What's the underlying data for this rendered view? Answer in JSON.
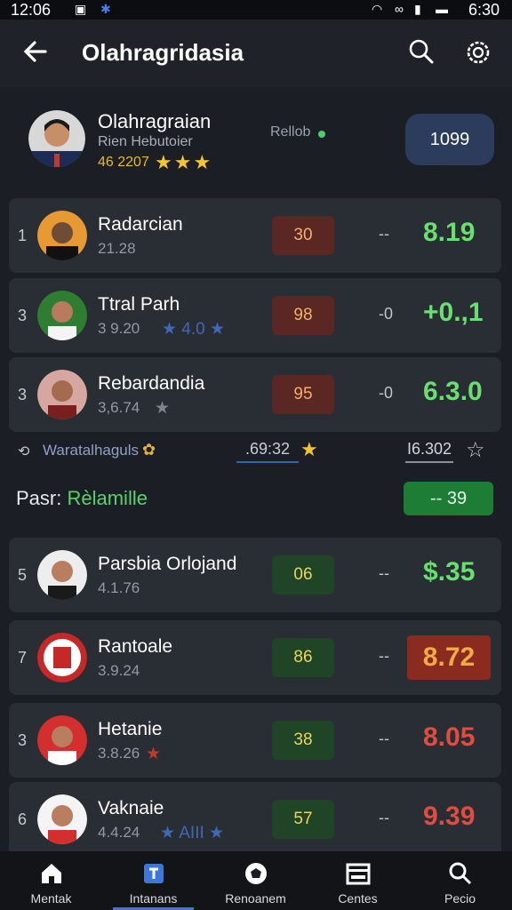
{
  "status": {
    "time_left": "12:06",
    "time_right": "6:30"
  },
  "app_bar": {
    "title": "Olahragridasia"
  },
  "profile": {
    "name": "Olahragraian",
    "subtitle": "Rien Hebutoier",
    "score": "46 2207",
    "stars": "★★★",
    "status": "Rellob",
    "badge": "1099"
  },
  "rows": [
    {
      "rank": "1",
      "name": "Radarcian",
      "sub": "21.28",
      "extra": "",
      "score": "30",
      "dash": "--",
      "value": "8.19",
      "value_color": "#69df6f",
      "score_bg": "#5a2722",
      "score_fg": "#f2b16c"
    },
    {
      "rank": "3",
      "name": "Ttral Parh",
      "sub": "3 9.20",
      "extra": "★ 4.0 ★",
      "extra_color": "#4068b8",
      "score": "98",
      "dash": "-0",
      "value": "+0.,1",
      "value_color": "#69df6f",
      "score_bg": "#5a2722",
      "score_fg": "#f2b16c"
    },
    {
      "rank": "3",
      "name": "Rebardandia",
      "sub": "3,6.74",
      "extra": "★",
      "extra_color": "#7f858d",
      "score": "95",
      "dash": "-0",
      "value": "6.3.0",
      "value_color": "#69df6f",
      "score_bg": "#5a2722",
      "score_fg": "#f2b16c"
    },
    {
      "rank": "5",
      "name": "Parsbia Orlojand",
      "sub": "4.1.76",
      "extra": "",
      "score": "06",
      "dash": "--",
      "value": "$.35",
      "value_color": "#69df6f",
      "score_bg": "#1f4526",
      "score_fg": "#e9d65b"
    },
    {
      "rank": "7",
      "name": "Rantoale",
      "sub": "3.9.24",
      "extra": "",
      "score": "86",
      "dash": "--",
      "value": "8.72",
      "value_color": "#f0ab45",
      "value_bg": "#8b2a1f",
      "score_bg": "#1f4526",
      "score_fg": "#e9d65b"
    },
    {
      "rank": "3",
      "name": "Hetanie",
      "sub": "3.8.26",
      "extra": "★",
      "extra_color": "#c0392b",
      "score": "38",
      "dash": "--",
      "value": "8.05",
      "value_color": "#e24c40",
      "score_bg": "#1f4526",
      "score_fg": "#e9d65b"
    },
    {
      "rank": "6",
      "name": "Vaknaie",
      "sub": "4.4.24",
      "extra": "★ AIII ★",
      "extra_color": "#4068b8",
      "score": "57",
      "dash": "--",
      "value": "9.39",
      "value_color": "#e24c40",
      "score_bg": "#1f4526",
      "score_fg": "#e9d65b"
    }
  ],
  "filter": {
    "label": "Waratalhaguls",
    "value1": ".69:32",
    "value2": "I6.302"
  },
  "section": {
    "prefix": "Pasr:",
    "highlight": "Rèlamille",
    "badge": "-- 39"
  },
  "bottom_nav": [
    {
      "label": "Mentak",
      "icon": "home-icon"
    },
    {
      "label": "Intanans",
      "icon": "team-icon",
      "active": true
    },
    {
      "label": "Renoanem",
      "icon": "ball-icon"
    },
    {
      "label": "Centes",
      "icon": "calendar-icon"
    },
    {
      "label": "Pecio",
      "icon": "search-icon"
    }
  ],
  "colors": {
    "background": "#1b1e24",
    "card": "#292d34",
    "accent_blue": "#3d78d8",
    "green": "#69df6f",
    "red": "#e24c40"
  }
}
